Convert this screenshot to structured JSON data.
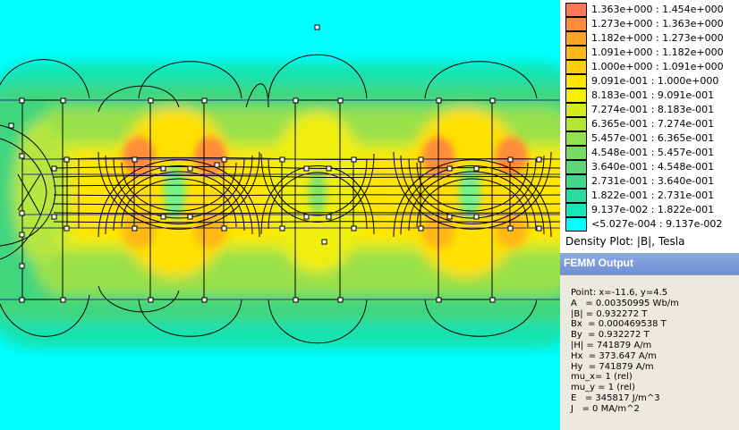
{
  "legend": {
    "items": [
      {
        "label": "1.363e+000 : 1.454e+000",
        "color": "#ff7755"
      },
      {
        "label": "1.273e+000 : 1.363e+000",
        "color": "#ff8c3a"
      },
      {
        "label": "1.182e+000 : 1.273e+000",
        "color": "#ffa326"
      },
      {
        "label": "1.091e+000 : 1.182e+000",
        "color": "#ffb817"
      },
      {
        "label": "1.000e+000 : 1.091e+000",
        "color": "#ffcd0b"
      },
      {
        "label": "9.091e-001 : 1.000e+000",
        "color": "#ffe600"
      },
      {
        "label": "8.183e-001 : 9.091e-001",
        "color": "#f2f000"
      },
      {
        "label": "7.274e-001 : 8.183e-001",
        "color": "#d2ec1c"
      },
      {
        "label": "6.365e-001 : 7.274e-001",
        "color": "#b2e636"
      },
      {
        "label": "5.457e-001 : 6.365e-001",
        "color": "#92e04e"
      },
      {
        "label": "4.548e-001 : 5.457e-001",
        "color": "#78da62"
      },
      {
        "label": "3.640e-001 : 4.548e-001",
        "color": "#5cd676"
      },
      {
        "label": "2.731e-001 : 3.640e-001",
        "color": "#44d68a"
      },
      {
        "label": "1.822e-001 : 2.731e-001",
        "color": "#28dc9e"
      },
      {
        "label": "9.137e-002 : 1.822e-001",
        "color": "#12eab6"
      },
      {
        "label": "<5.027e-004 : 9.137e-002",
        "color": "#00ffff"
      }
    ],
    "caption": "Density Plot: |B|, Tesla"
  },
  "output": {
    "title": "FEMM Output",
    "lines": [
      "Point: x=-11.6, y=4.5",
      "A   = 0.00350995 Wb/m",
      "|B| = 0.932272 T",
      "Bx  = 0.000469538 T",
      "By  = 0.932272 T",
      "|H| = 741879 A/m",
      "Hx  = 373.647 A/m",
      "Hy  = 741879 A/m",
      "mu_x= 1 (rel)",
      "mu_y = 1 (rel)",
      "E   = 345817 J/m^3",
      "J   = 0 MA/m^2"
    ]
  },
  "colors": {
    "air": "#00ffff",
    "low": "#40e090",
    "mid": "#c8ec30",
    "high": "#ffe600",
    "peak": "#ff8c3a",
    "titlebar": "#7b97da"
  }
}
